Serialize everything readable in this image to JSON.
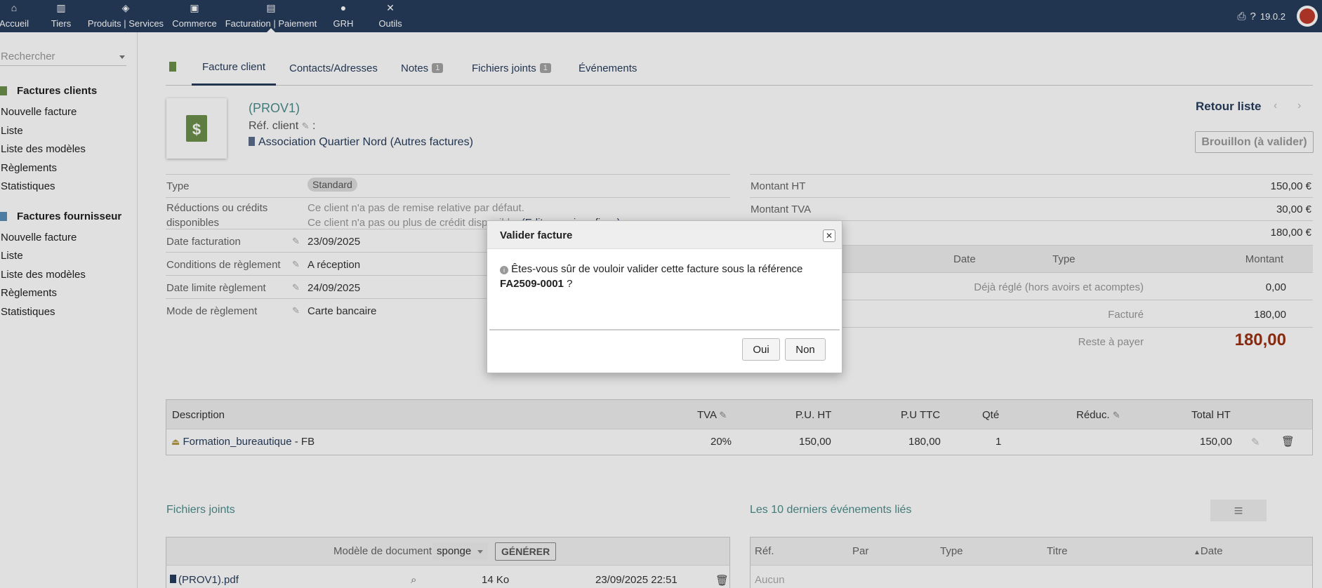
{
  "topnav": {
    "items": [
      {
        "label": "Accueil",
        "icon": "home-icon"
      },
      {
        "label": "Tiers",
        "icon": "building-icon"
      },
      {
        "label": "Produits | Services",
        "icon": "cube-icon"
      },
      {
        "label": "Commerce",
        "icon": "briefcase-icon"
      },
      {
        "label": "Facturation | Paiement",
        "icon": "invoice-icon"
      },
      {
        "label": "GRH",
        "icon": "user-icon"
      },
      {
        "label": "Outils",
        "icon": "tools-icon"
      }
    ],
    "version": "19.0.2"
  },
  "sidebar": {
    "search_placeholder": "Rechercher",
    "section1": {
      "title": "Factures clients",
      "items": [
        "Nouvelle facture",
        "Liste",
        "Liste des modèles",
        "Règlements",
        "Statistiques"
      ]
    },
    "section2": {
      "title": "Factures fournisseur",
      "items": [
        "Nouvelle facture",
        "Liste",
        "Liste des modèles",
        "Règlements",
        "Statistiques"
      ]
    }
  },
  "tabs": {
    "t1": "Facture client",
    "t2": "Contacts/Adresses",
    "t3": "Notes",
    "t3_badge": "1",
    "t4": "Fichiers joints",
    "t4_badge": "1",
    "t5": "Événements"
  },
  "header": {
    "ref": "(PROV1)",
    "ref_client": "Réf. client",
    "ref_client_sep": ":",
    "thirdparty": "Association Quartier Nord",
    "other_invoices": "(Autres factures)",
    "back": "Retour liste",
    "status_button": "Brouillon (à valider)"
  },
  "fields": {
    "type_label": "Type",
    "type_value": "Standard",
    "reductions_label": "Réductions ou crédits disponibles",
    "reductions_v1": "Ce client n'a pas de remise relative par défaut.",
    "reductions_v2": "Ce client n'a pas ou plus de crédit disponible.",
    "reductions_link": "(Editer remises fixes)",
    "date_label": "Date facturation",
    "date_value": "23/09/2025",
    "cond_label": "Conditions de règlement",
    "cond_value": "A réception",
    "due_label": "Date limite règlement",
    "due_value": "24/09/2025",
    "mode_label": "Mode de règlement",
    "mode_value": "Carte bancaire"
  },
  "amounts": {
    "ht_label": "Montant HT",
    "ht": "150,00 €",
    "tva_label": "Montant TVA",
    "tva": "30,00 €",
    "ttc": "180,00 €",
    "col_date": "Date",
    "col_type": "Type",
    "col_amount": "Montant",
    "paid_label": "Déjà réglé (hors avoirs et acomptes)",
    "paid": "0,00",
    "billed_label": "Facturé",
    "billed": "180,00",
    "remain_label": "Reste à payer",
    "remain": "180,00"
  },
  "lines": {
    "headers": {
      "desc": "Description",
      "tva": "TVA",
      "pu_ht": "P.U. HT",
      "pu_ttc": "P.U TTC",
      "qty": "Qté",
      "reduc": "Réduc.",
      "total": "Total HT"
    },
    "row": {
      "product": "Formation_bureautique",
      "desc_suffix": " - FB",
      "tva": "20%",
      "pu_ht": "150,00",
      "pu_ttc": "180,00",
      "qty": "1",
      "total": "150,00"
    }
  },
  "files": {
    "title": "Fichiers joints",
    "model_label": "Modèle de document",
    "model_value": "sponge",
    "generate": "GÉNÉRER",
    "file_name": "(PROV1).pdf",
    "file_size": "14 Ko",
    "file_date": "23/09/2025 22:51"
  },
  "events": {
    "title": "Les 10 derniers événements liés",
    "cols": {
      "ref": "Réf.",
      "by": "Par",
      "type": "Type",
      "title": "Titre",
      "date": "Date"
    },
    "empty": "Aucun"
  },
  "dialog": {
    "title": "Valider facture",
    "message": "Êtes-vous sûr de vouloir valider cette facture sous la référence",
    "reference": "FA2509-0001",
    "question_mark": " ?",
    "yes": "Oui",
    "no": "Non"
  },
  "colors": {
    "topbar": "#263c5c",
    "accent": "#4d8d8c",
    "remain": "#993013",
    "icon_green": "#6c8f4b"
  }
}
